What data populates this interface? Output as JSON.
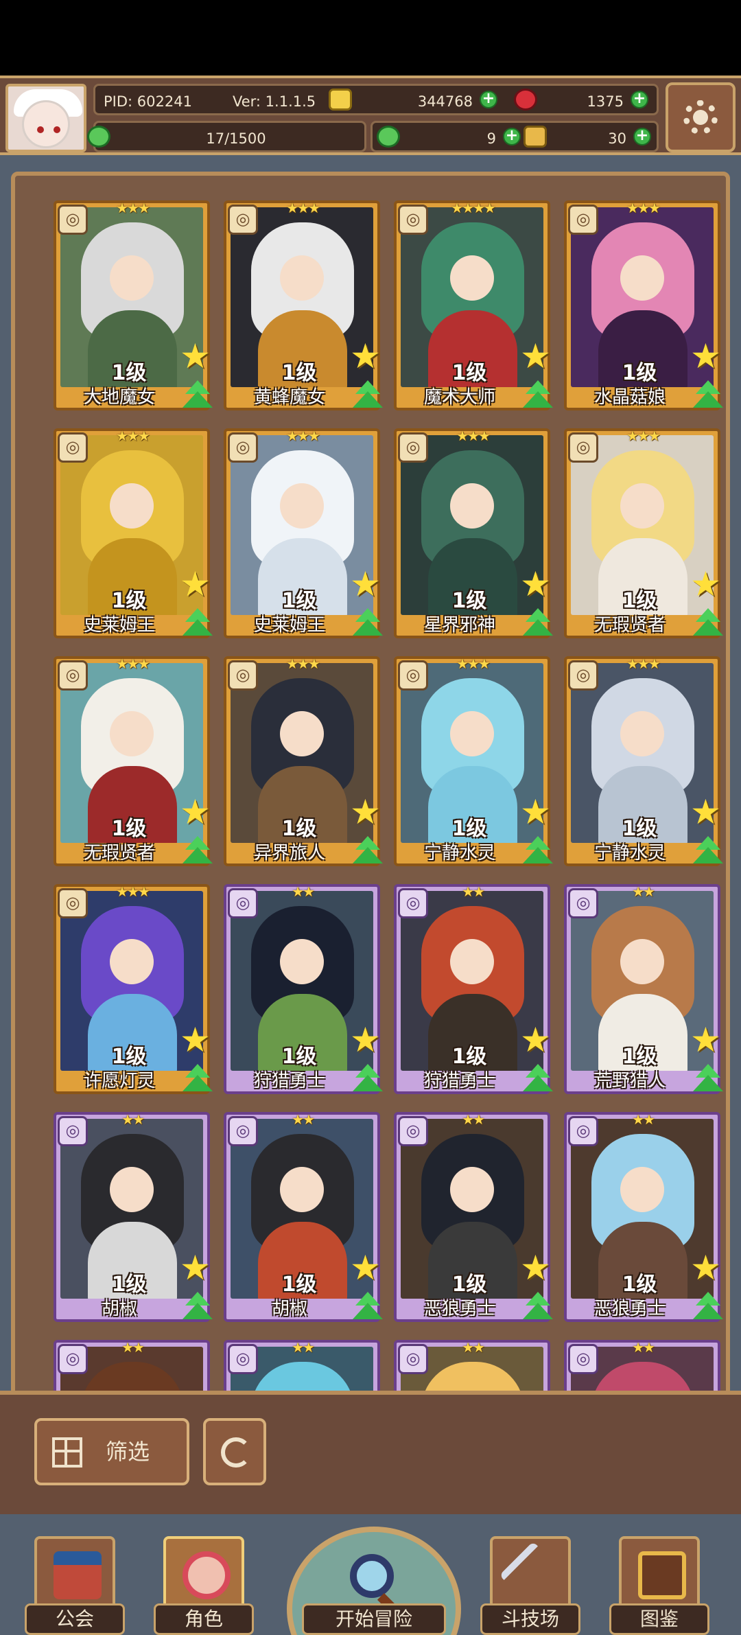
{
  "header": {
    "pid": "PID: 602241",
    "version": "Ver: 1.1.1.5",
    "gold": "344768",
    "gems": "1375",
    "clover_progress": "17/1500",
    "energy": "9",
    "tickets": "30"
  },
  "filter": {
    "filter_label": "筛选"
  },
  "nav": {
    "guild": "公会",
    "character": "角色",
    "adventure": "开始冒险",
    "arena": "斗技场",
    "codex": "图鉴"
  },
  "cards": [
    {
      "name": "大地魔女",
      "level": "1级",
      "stars": 3,
      "rarity": "gold",
      "bg": "#5f7a55",
      "hair": "#d9d9d9",
      "body": "#4c6a46"
    },
    {
      "name": "黄蜂魔女",
      "level": "1级",
      "stars": 3,
      "rarity": "gold",
      "bg": "#2a2a30",
      "hair": "#e8e8e8",
      "body": "#c98a2e"
    },
    {
      "name": "魔术大师",
      "level": "1级",
      "stars": 4,
      "rarity": "gold",
      "bg": "#3c4a45",
      "hair": "#3e8a6a",
      "body": "#b53030"
    },
    {
      "name": "水晶菇娘",
      "level": "1级",
      "stars": 3,
      "rarity": "gold",
      "bg": "#4a2a5e",
      "hair": "#e386b4",
      "body": "#3a1e44"
    },
    {
      "name": "史莱姆王",
      "level": "1级",
      "stars": 3,
      "rarity": "gold",
      "bg": "#c9a02e",
      "hair": "#e8c03e",
      "body": "#c4941e"
    },
    {
      "name": "史莱姆王",
      "level": "1级",
      "stars": 3,
      "rarity": "gold",
      "bg": "#7a8da0",
      "hair": "#f0f4f8",
      "body": "#d6e0ea"
    },
    {
      "name": "星界邪神",
      "level": "1级",
      "stars": 3,
      "rarity": "gold",
      "bg": "#2c3e3a",
      "hair": "#3d6e5c",
      "body": "#2a4a40"
    },
    {
      "name": "无瑕贤者",
      "level": "1级",
      "stars": 3,
      "rarity": "gold",
      "bg": "#d8d0c2",
      "hair": "#f2d985",
      "body": "#efe8de"
    },
    {
      "name": "无瑕贤者",
      "level": "1级",
      "stars": 3,
      "rarity": "gold",
      "bg": "#6aa5a8",
      "hair": "#f2efe8",
      "body": "#9c2a2a"
    },
    {
      "name": "异界旅人",
      "level": "1级",
      "stars": 3,
      "rarity": "gold",
      "bg": "#5a4a3a",
      "hair": "#2a2e3a",
      "body": "#7a5a3a"
    },
    {
      "name": "宁静水灵",
      "level": "1级",
      "stars": 3,
      "rarity": "gold",
      "bg": "#4e6a78",
      "hair": "#8ed6e8",
      "body": "#7cc8e0"
    },
    {
      "name": "宁静水灵",
      "level": "1级",
      "stars": 3,
      "rarity": "gold",
      "bg": "#4a5566",
      "hair": "#d0d8e4",
      "body": "#b8c4d2"
    },
    {
      "name": "许愿灯灵",
      "level": "1级",
      "stars": 3,
      "rarity": "gold",
      "bg": "#2e3c6a",
      "hair": "#6a4ac8",
      "body": "#6ab0e0"
    },
    {
      "name": "狩猎勇士",
      "level": "1级",
      "stars": 2,
      "rarity": "purple",
      "bg": "#3a4a5a",
      "hair": "#1a2030",
      "body": "#6a9a4a"
    },
    {
      "name": "狩猎勇士",
      "level": "1级",
      "stars": 2,
      "rarity": "purple",
      "bg": "#3a3a48",
      "hair": "#c24a2e",
      "body": "#3a3028"
    },
    {
      "name": "荒野猎人",
      "level": "1级",
      "stars": 2,
      "rarity": "purple",
      "bg": "#5a6a7a",
      "hair": "#b87a4a",
      "body": "#f0ece4"
    },
    {
      "name": "胡椒",
      "level": "1级",
      "stars": 2,
      "rarity": "purple",
      "bg": "#4a5060",
      "hair": "#2a2a2e",
      "body": "#d8d8d8"
    },
    {
      "name": "胡椒",
      "level": "1级",
      "stars": 2,
      "rarity": "purple",
      "bg": "#3e5068",
      "hair": "#2a2a2e",
      "body": "#c04a2e"
    },
    {
      "name": "恶狼勇士",
      "level": "1级",
      "stars": 2,
      "rarity": "purple",
      "bg": "#4a3a2e",
      "hair": "#20242e",
      "body": "#3a3a3a"
    },
    {
      "name": "恶狼勇士",
      "level": "1级",
      "stars": 2,
      "rarity": "purple",
      "bg": "#4e3a2e",
      "hair": "#9ad0ea",
      "body": "#6a4a3a"
    },
    {
      "name": "",
      "level": "",
      "stars": 2,
      "rarity": "purple",
      "bg": "#5a3a2e",
      "hair": "#6a3a22",
      "body": "#6a3a22"
    },
    {
      "name": "",
      "level": "",
      "stars": 2,
      "rarity": "purple",
      "bg": "#3a5a6a",
      "hair": "#6ac8e0",
      "body": "#6ac8e0"
    },
    {
      "name": "",
      "level": "",
      "stars": 2,
      "rarity": "purple",
      "bg": "#6a5a3a",
      "hair": "#f0c060",
      "body": "#f0c060"
    },
    {
      "name": "",
      "level": "",
      "stars": 2,
      "rarity": "purple",
      "bg": "#5a3a4a",
      "hair": "#c04a6a",
      "body": "#c04a6a"
    }
  ],
  "icons": {
    "coin": "coin-icon",
    "gem": "red-gem-icon",
    "clover": "clover-icon",
    "energy": "green-clover-icon",
    "ticket": "ticket-icon",
    "settings": "gear-icon"
  },
  "colors": {
    "gold_frame": "#e0a03a",
    "purple_frame": "#c7a5de",
    "panel": "#7a5a45"
  }
}
